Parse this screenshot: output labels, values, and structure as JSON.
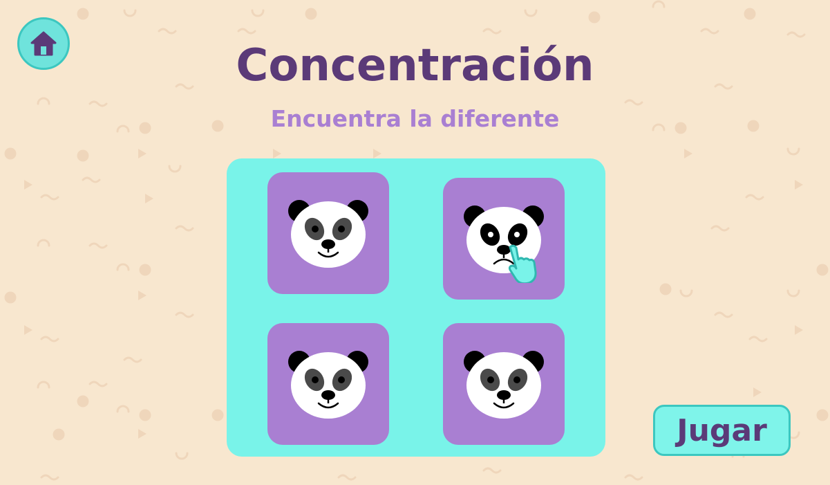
{
  "header": {
    "title": "Concentración",
    "subtitle": "Encuentra la diferente"
  },
  "nav": {
    "home_icon": "home-icon"
  },
  "game": {
    "cards": [
      {
        "expression": "smiling"
      },
      {
        "expression": "sad",
        "different": true
      },
      {
        "expression": "smiling"
      },
      {
        "expression": "smiling"
      }
    ]
  },
  "actions": {
    "play_label": "Jugar"
  },
  "colors": {
    "background": "#f8e7cf",
    "title": "#5b3a78",
    "subtitle": "#a97fd2",
    "board": "#79f3e9",
    "card": "#a97fd2",
    "accent": "#6fe3dc"
  }
}
